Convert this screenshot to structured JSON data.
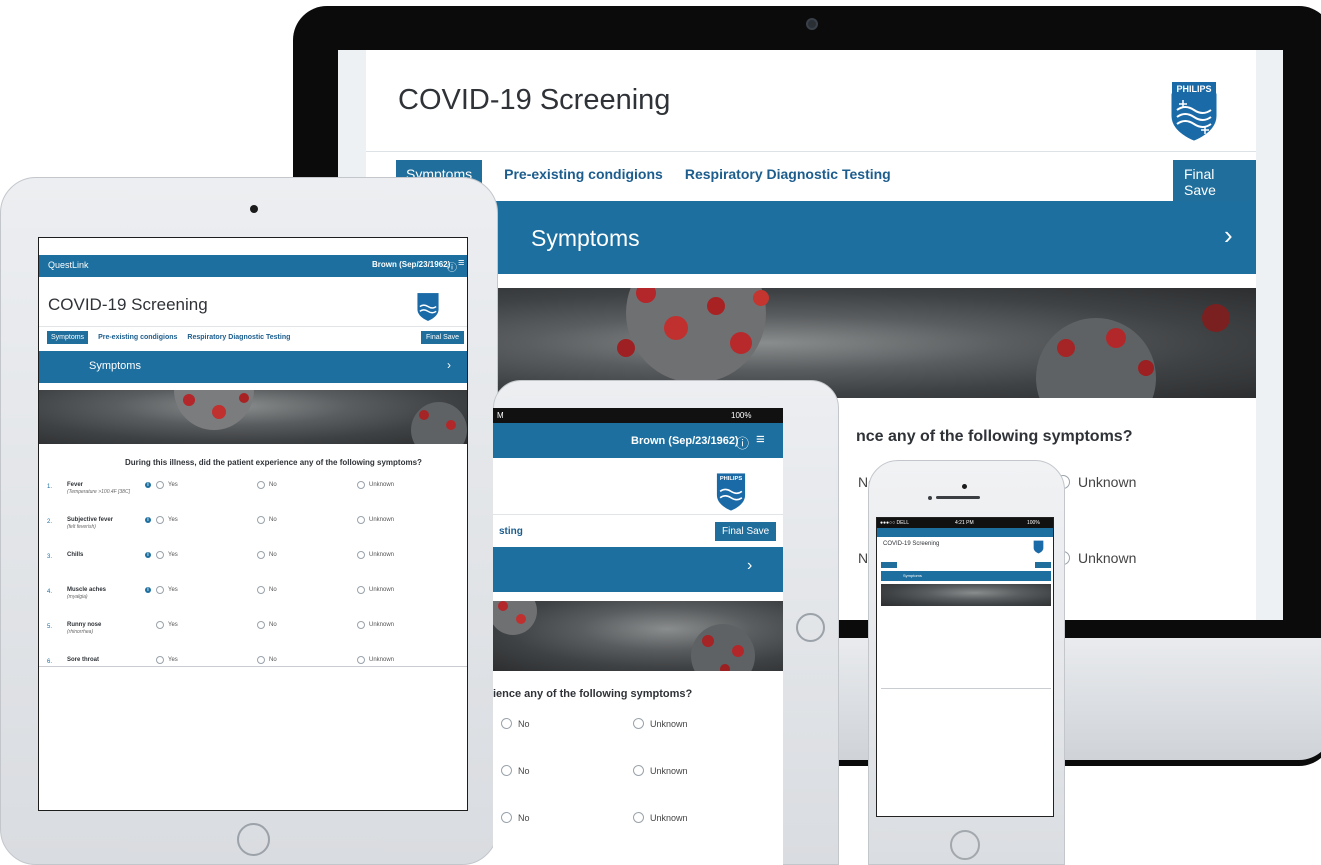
{
  "desktop": {
    "title": "COVID-19 Screening",
    "logo_text": "PHILIPS",
    "tabs": [
      "Symptoms",
      "Pre-existing condigions",
      "Respiratory Diagnostic Testing"
    ],
    "final_save": "Final Save",
    "section_title": "Symptoms",
    "question": "nce any of the following symptoms?",
    "option_no": "No",
    "option_unknown": "Unknown"
  },
  "tablet": {
    "brand": "QuestLink",
    "user": "Brown (Sep/23/1962)",
    "title": "COVID-19 Screening",
    "logo_text": "PHILIPS",
    "tabs": [
      "Symptoms",
      "Pre-existing condigions",
      "Respiratory Diagnostic Testing"
    ],
    "final_save": "Final Save",
    "section_title": "Symptoms",
    "question": "During this illness, did the patient experience any of the following symptoms?",
    "option_yes": "Yes",
    "option_no": "No",
    "option_unknown": "Unknown",
    "rows": [
      {
        "num": "1.",
        "name": "Fever",
        "note": "(Temperature >100.4F [38C]",
        "info": true
      },
      {
        "num": "2.",
        "name": "Subjective fever",
        "note": "(felt feverish)",
        "info": true
      },
      {
        "num": "3.",
        "name": "Chills",
        "note": "",
        "info": true
      },
      {
        "num": "4.",
        "name": "Muscle aches",
        "note": "(myalgia)",
        "info": true
      },
      {
        "num": "5.",
        "name": "Runny nose",
        "note": "(rhinorrhea)",
        "info": false
      },
      {
        "num": "6.",
        "name": "Sore throat",
        "note": "",
        "info": false
      }
    ]
  },
  "tablet2": {
    "status_left": "M",
    "status_right": "100%",
    "user": "Brown (Sep/23/1962)",
    "logo_text": "PHILIPS",
    "tab": "sting",
    "final_save": "Final Save",
    "question": "ience any of the following symptoms?",
    "option_no": "No",
    "option_unknown": "Unknown"
  },
  "phone": {
    "status_left": "●●●○○ DELL",
    "status_time": "4:21 PM",
    "status_right": "100%",
    "title": "COVID-19 Screening",
    "section_title": "Symptoms"
  },
  "colors": {
    "brand_blue": "#1c6f9f",
    "tab_blue": "#1f6e9c",
    "link_blue": "#1c5d8d"
  }
}
